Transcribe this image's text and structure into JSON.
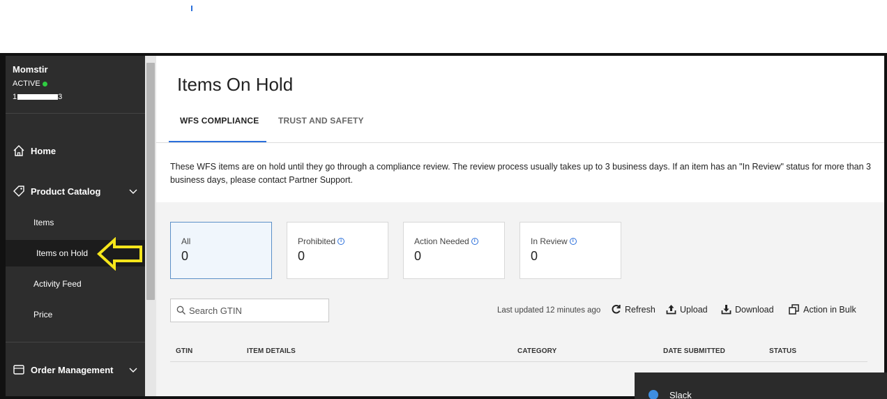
{
  "sidebar": {
    "seller_name": "Momstir",
    "status": "ACTIVE",
    "status_color": "#2ecc40",
    "seller_id_visible_start": "1",
    "seller_id_visible_end": "3",
    "nav": {
      "home_label": "Home",
      "home_icon": "home-icon",
      "product_catalog_label": "Product Catalog",
      "product_catalog_icon": "tag-icon",
      "items": [
        {
          "label": "Items"
        },
        {
          "label": "Items on Hold"
        },
        {
          "label": "Activity Feed"
        },
        {
          "label": "Price"
        }
      ],
      "order_management_label": "Order Management",
      "order_management_icon": "box-icon"
    }
  },
  "main": {
    "title": "Items On Hold",
    "tabs": [
      {
        "label": "WFS COMPLIANCE",
        "active": true
      },
      {
        "label": "TRUST AND SAFETY",
        "active": false
      }
    ],
    "notice": "These WFS items are on hold until they go through a compliance review. The review process usually takes up to 3 business days. If an item has an \"In Review\" status for more than 3 business days, please contact Partner Support.",
    "cards": [
      {
        "label": "All",
        "count": "0",
        "selected": true
      },
      {
        "label": "Prohibited",
        "count": "0",
        "info": true
      },
      {
        "label": "Action Needed",
        "count": "0",
        "info": true
      },
      {
        "label": "In Review",
        "count": "0",
        "info": true
      }
    ],
    "search": {
      "placeholder": "Search GTIN"
    },
    "last_updated": "Last updated 12 minutes ago",
    "actions": {
      "refresh": "Refresh",
      "upload": "Upload",
      "download": "Download",
      "bulk": "Action in Bulk"
    },
    "table_headers": [
      "GTIN",
      "ITEM DETAILS",
      "CATEGORY",
      "DATE SUBMITTED",
      "STATUS"
    ]
  },
  "taskbar": {
    "app_label": "Slack"
  },
  "colors": {
    "accent": "#2a6fdb",
    "sidebar_bg": "#2d2d2d",
    "highlight_arrow": "#f5e51b"
  }
}
